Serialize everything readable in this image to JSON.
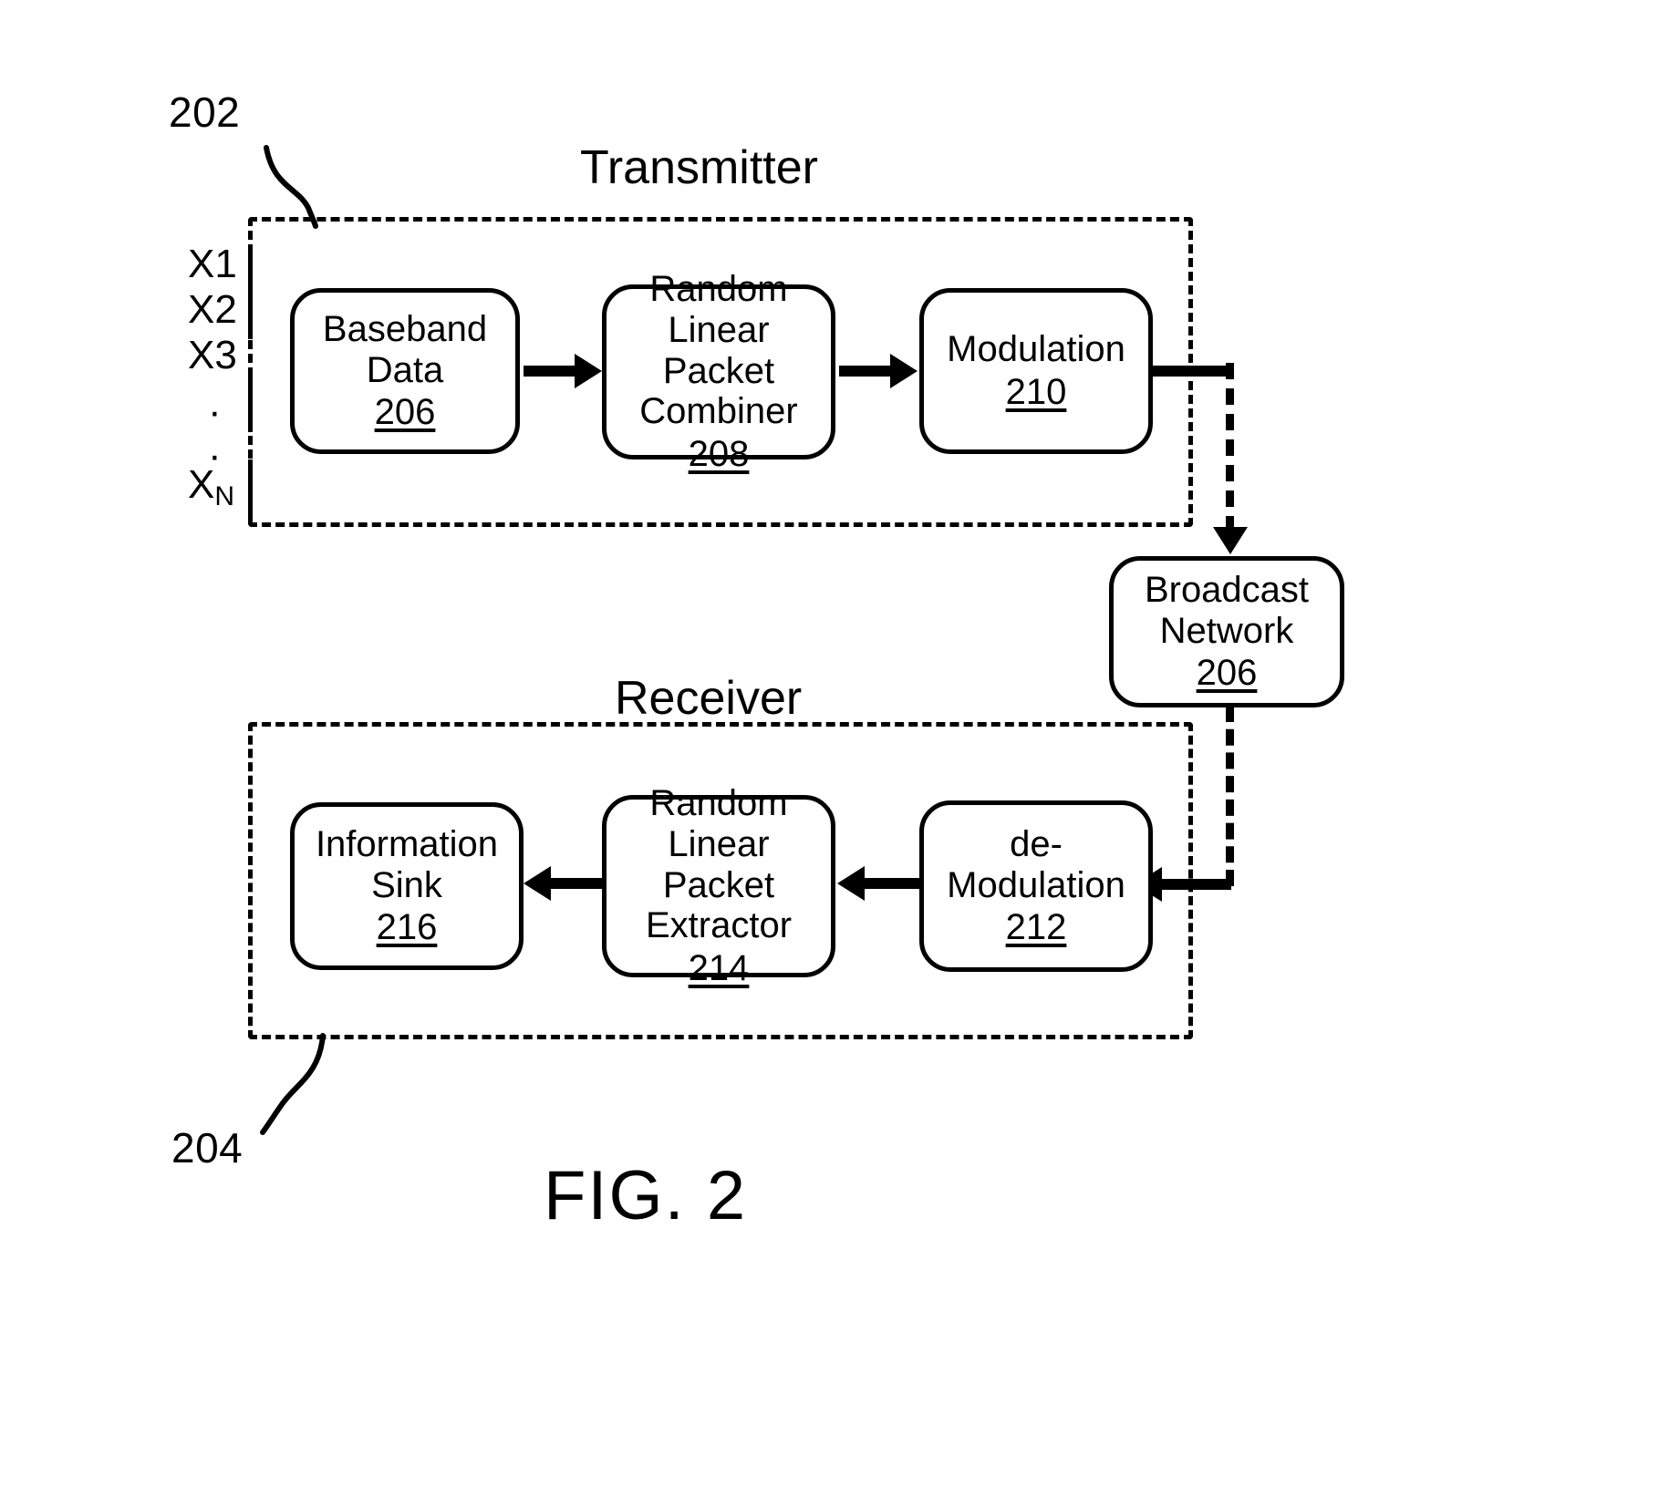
{
  "figure": {
    "caption": "FIG. 2",
    "transmitter_ref": "202",
    "receiver_ref": "204"
  },
  "sections": {
    "transmitter": {
      "title": "Transmitter"
    },
    "receiver": {
      "title": "Receiver"
    }
  },
  "inputs": {
    "labels": [
      "X1",
      "X2",
      "X3"
    ],
    "ellipsis": "·",
    "last_base": "X",
    "last_sub": "N"
  },
  "blocks": {
    "baseband_data": {
      "label": "Baseband\nData",
      "number": "206"
    },
    "packet_combiner": {
      "label": "Random\nLinear Packet\nCombiner",
      "number": "208"
    },
    "modulation": {
      "label": "Modulation",
      "number": "210"
    },
    "broadcast": {
      "label": "Broadcast\nNetwork",
      "number": "206"
    },
    "demodulation": {
      "label": "de-\nModulation",
      "number": "212"
    },
    "packet_extractor": {
      "label": "Random\nLinear Packet\nExtractor",
      "number": "214"
    },
    "info_sink": {
      "label": "Information\nSink",
      "number": "216"
    }
  },
  "colors": {
    "ink": "#000000",
    "paper": "#ffffff"
  }
}
